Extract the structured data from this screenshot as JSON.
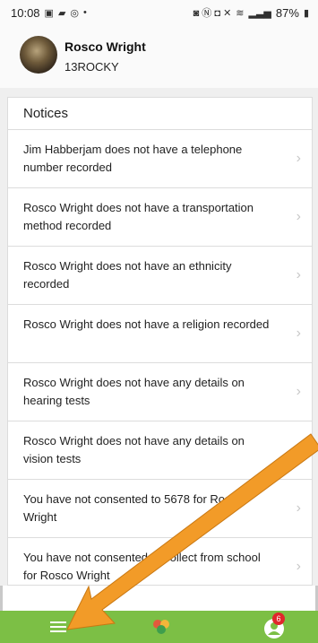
{
  "status_bar": {
    "time": "10:08",
    "battery": "87%"
  },
  "header": {
    "name": "Rosco Wright",
    "code": "13ROCKY"
  },
  "notices": {
    "title": "Notices",
    "items": [
      "Jim Habberjam does not have a telephone number recorded",
      "Rosco Wright does not have a transportation method recorded",
      "Rosco Wright does not have an ethnicity recorded",
      "Rosco Wright does not have a religion recorded",
      "Rosco Wright does not have any details on hearing tests",
      "Rosco Wright does not have any details on vision tests",
      "You have not consented to 5678 for Rosco Wright",
      "You have not consented to collect from school for Rosco Wright"
    ]
  },
  "bottom_nav": {
    "notification_count": "6"
  },
  "colors": {
    "bar_green": "#7cbf45",
    "arrow_orange": "#f29b28",
    "badge_red": "#e0262c"
  }
}
